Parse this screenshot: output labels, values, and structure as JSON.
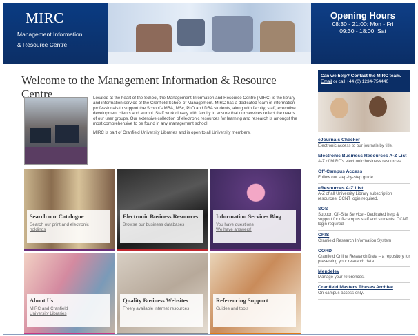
{
  "header": {
    "brand_name": "MIRC",
    "brand_line1": "Management Information",
    "brand_line2": "& Resource Centre",
    "hours_title": "Opening Hours",
    "hours_line1": "08:30 - 21:00: Mon - Fri",
    "hours_line2": "09:30 - 18:00: Sat"
  },
  "main": {
    "title": "Welcome to the Management Information & Resource Centre",
    "intro_p1": "Located at the heart of the School, the Management Information and Resource Centre (MIRC) is the library and information service of the Cranfield School of Management. MIRC has a dedicated team of information professionals to support the School's MBA, MSc, PhD and DBA students, along with faculty, staff, executive development clients and alumni. Staff work closely with faculty to ensure that our services reflect the needs of our user groups. Our extensive collection of electronic resources for learning and research is amongst the most comprehensive to be found in any management school.",
    "intro_p2": "MIRC is part of Cranfield University Libraries and is open to all University members."
  },
  "tiles": [
    {
      "title": "Search our Catalogue",
      "sub1": "Search our print and electronic",
      "sub2": "holdings",
      "accent": "#6a2d7a"
    },
    {
      "title": "Electronic Business Resources",
      "sub1": "Browse our business databases",
      "sub2": "",
      "accent": "#c0262d"
    },
    {
      "title": "Information Services Blog",
      "sub1": "You have questions",
      "sub2": "We have answers!",
      "accent": "#6a2d7a"
    },
    {
      "title": "About Us",
      "sub1": "MIRC and Cranfield",
      "sub2": "University Libraries",
      "accent": "#c63a83"
    },
    {
      "title": "Quality Business Websites",
      "sub1": "Freely available internet resources",
      "sub2": "",
      "accent": "#8a8a8a"
    },
    {
      "title": "Referencing Support",
      "sub1": "Guides and tools",
      "sub2": "",
      "accent": "#e07b1a"
    }
  ],
  "help": {
    "line1": "Can we help? Contact the MIRC team.",
    "email": "Email",
    "line2": "or call +44 (0) 1234-754440"
  },
  "links": [
    {
      "title": "eJournals Checker",
      "desc": "Electronic access to our journals by title."
    },
    {
      "title": "Electronic Business Resources A-Z List",
      "desc": "A-Z of MIRC's electronic business resources."
    },
    {
      "title": "Off-Campus Access",
      "desc": "Follow our step-by-step guide."
    },
    {
      "title": "eResources A-Z List",
      "desc": "A-Z of all University Library subscription resources. CCNT login required."
    },
    {
      "title": "SOS",
      "desc": "Support Off-Site Service - Dedicated help & support for off-campus staff and students. CCNT login required."
    },
    {
      "title": "CRIS",
      "desc": "Cranfield Research Information System"
    },
    {
      "title": "CORD",
      "desc": "Cranfield Online Research Data – a repository for preserving your research data."
    },
    {
      "title": "Mendeley",
      "desc": "Manage your references."
    },
    {
      "title": "Cranfield Masters Theses Archive",
      "desc": "On-campus access only."
    }
  ]
}
